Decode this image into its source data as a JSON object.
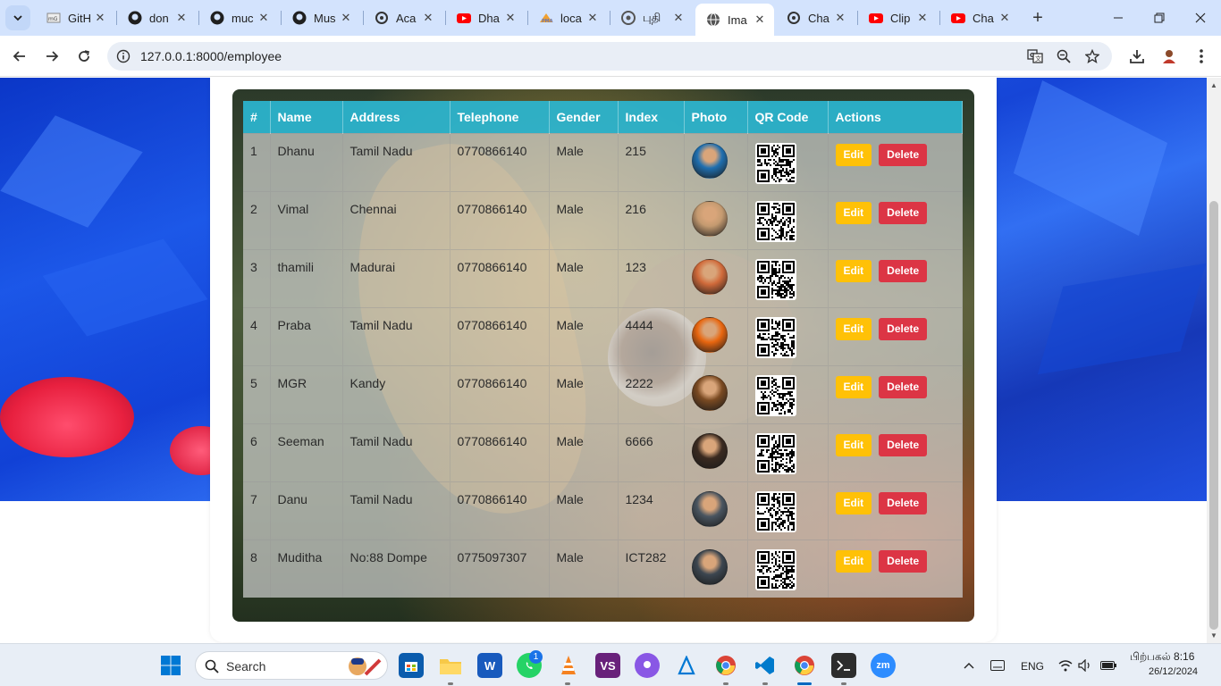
{
  "browser": {
    "tabs": [
      {
        "title": "GitH",
        "icon": "page-icon",
        "active": false
      },
      {
        "title": "don",
        "icon": "github-icon",
        "active": false
      },
      {
        "title": "muc",
        "icon": "github-icon",
        "active": false
      },
      {
        "title": "Mus",
        "icon": "github-icon",
        "active": false
      },
      {
        "title": "Aca",
        "icon": "openai-icon",
        "active": false
      },
      {
        "title": "Dha",
        "icon": "youtube-icon",
        "active": false
      },
      {
        "title": "loca",
        "icon": "phpmyadmin-icon",
        "active": false
      },
      {
        "title": "புதி",
        "icon": "chrome-icon",
        "active": false
      },
      {
        "title": "Ima",
        "icon": "globe-icon",
        "active": true
      },
      {
        "title": "Cha",
        "icon": "openai-icon",
        "active": false
      },
      {
        "title": "Clip",
        "icon": "youtube-icon",
        "active": false
      },
      {
        "title": "Cha",
        "icon": "youtube-icon",
        "active": false
      }
    ],
    "url": "127.0.0.1:8000/employee"
  },
  "table": {
    "headers": [
      "#",
      "Name",
      "Address",
      "Telephone",
      "Gender",
      "Index",
      "Photo",
      "QR Code",
      "Actions"
    ],
    "edit_label": "Edit",
    "delete_label": "Delete",
    "rows": [
      {
        "no": "1",
        "name": "Dhanu",
        "address": "Tamil Nadu",
        "telephone": "0770866140",
        "gender": "Male",
        "index": "215",
        "photo_color": "#1f6fb0"
      },
      {
        "no": "2",
        "name": "Vimal",
        "address": "Chennai",
        "telephone": "0770866140",
        "gender": "Male",
        "index": "216",
        "photo_color": "#c49a70"
      },
      {
        "no": "3",
        "name": "thamili",
        "address": "Madurai",
        "telephone": "0770866140",
        "gender": "Male",
        "index": "123",
        "photo_color": "#d06a3a"
      },
      {
        "no": "4",
        "name": "Praba",
        "address": "Tamil Nadu",
        "telephone": "0770866140",
        "gender": "Male",
        "index": "4444",
        "photo_color": "#e8660f"
      },
      {
        "no": "5",
        "name": "MGR",
        "address": "Kandy",
        "telephone": "0770866140",
        "gender": "Male",
        "index": "2222",
        "photo_color": "#7a4a22"
      },
      {
        "no": "6",
        "name": "Seeman",
        "address": "Tamil Nadu",
        "telephone": "0770866140",
        "gender": "Male",
        "index": "6666",
        "photo_color": "#3a2a20"
      },
      {
        "no": "7",
        "name": "Danu",
        "address": "Tamil Nadu",
        "telephone": "0770866140",
        "gender": "Male",
        "index": "1234",
        "photo_color": "#4a5560"
      },
      {
        "no": "8",
        "name": "Muditha",
        "address": "No:88 Dompe",
        "telephone": "0775097307",
        "gender": "Male",
        "index": "ICT282",
        "photo_color": "#3c4650"
      }
    ]
  },
  "taskbar": {
    "search_label": "Search",
    "whatsapp_badge": "1",
    "language": "ENG",
    "time": "பிற்பகல் 8:16",
    "date": "26/12/2024"
  },
  "colors": {
    "header_bg": "#2bb6d1",
    "edit_button": "#ffc107",
    "delete_button": "#dc3545"
  }
}
